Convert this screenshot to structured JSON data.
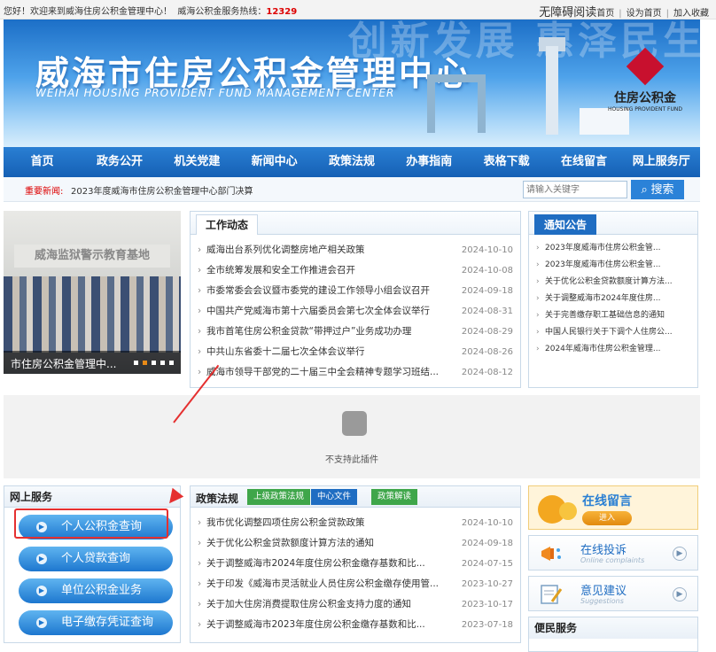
{
  "topbar": {
    "welcome": "您好！欢迎来到威海住房公积金管理中心！",
    "hotline_label": "威海公积金服务热线：",
    "hotline_number": "12329",
    "accessible": "无障碍阅读",
    "home": "首页",
    "set_home": "设为首页",
    "favorite": "加入收藏"
  },
  "banner": {
    "slogan": "创新发展 惠泽民生",
    "title_cn": "威海市住房公积金管理中心",
    "title_en": "WEIHAI HOUSING PROVIDENT FUND MANAGEMENT CENTER",
    "logo_cn": "住房公积金",
    "logo_en": "HOUSING PROVIDENT FUND"
  },
  "nav": [
    "首页",
    "政务公开",
    "机关党建",
    "新闻中心",
    "政策法规",
    "办事指南",
    "表格下载",
    "在线留言",
    "网上服务厅"
  ],
  "newsbar": {
    "label": "重要新闻:",
    "headline": "2023年度威海市住房公积金管理中心部门决算",
    "search_placeholder": "请输入关键字",
    "search_button": "搜索"
  },
  "photo": {
    "sign": "威海监狱警示教育基地",
    "caption": "市住房公积金管理中..."
  },
  "work": {
    "title": "工作动态",
    "items": [
      {
        "title": "威海出台系列优化调整房地产相关政策",
        "date": "2024-10-10"
      },
      {
        "title": "全市统筹发展和安全工作推进会召开",
        "date": "2024-10-08"
      },
      {
        "title": "市委常委会会议暨市委党的建设工作领导小组会议召开",
        "date": "2024-09-18"
      },
      {
        "title": "中国共产党威海市第十六届委员会第七次全体会议举行",
        "date": "2024-08-31"
      },
      {
        "title": "我市首笔住房公积金贷款“带押过户”业务成功办理",
        "date": "2024-08-29"
      },
      {
        "title": "中共山东省委十二届七次全体会议举行",
        "date": "2024-08-26"
      },
      {
        "title": "威海市领导干部党的二十届三中全会精神专题学习班结...",
        "date": "2024-08-12"
      }
    ]
  },
  "notice": {
    "title": "通知公告",
    "items": [
      "2023年度威海市住房公积金管...",
      "2023年度威海市住房公积金管...",
      "关于优化公积金贷款额度计算方法...",
      "关于调整威海市2024年度住房...",
      "关于完善缴存职工基础信息的通知",
      "中国人民银行关于下调个人住房公...",
      "2024年威海市住房公积金管理..."
    ]
  },
  "plugin": {
    "message": "不支持此插件"
  },
  "services": {
    "title": "网上服务",
    "buttons": [
      "个人公积金查询",
      "个人贷款查询",
      "单位公积金业务",
      "电子缴存凭证查询"
    ]
  },
  "policy": {
    "title": "政策法规",
    "tabs": [
      "上级政策法规",
      "中心文件",
      "政策解读"
    ],
    "items": [
      {
        "title": "我市优化调整四项住房公积金贷款政策",
        "date": "2024-10-10"
      },
      {
        "title": "关于优化公积金贷款额度计算方法的通知",
        "date": "2024-09-18"
      },
      {
        "title": "关于调整威海市2024年度住房公积金缴存基数和比...",
        "date": "2024-07-15"
      },
      {
        "title": "关于印发《威海市灵活就业人员住房公积金缴存使用管...",
        "date": "2023-10-27"
      },
      {
        "title": "关于加大住房消费提取住房公积金支持力度的通知",
        "date": "2023-10-17"
      },
      {
        "title": "关于调整威海市2023年度住房公积金缴存基数和比...",
        "date": "2023-07-18"
      }
    ]
  },
  "side": {
    "message_title": "在线留言",
    "message_enter": "进入",
    "complaint_title": "在线投诉",
    "complaint_en": "Online complaints",
    "suggest_title": "意见建议",
    "suggest_en": "Suggestions",
    "convenience_title": "便民服务"
  }
}
